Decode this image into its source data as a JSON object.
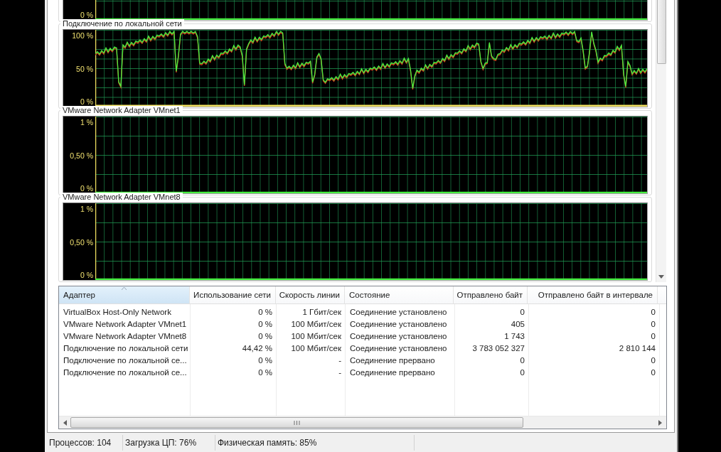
{
  "graphs": [
    {
      "kind": "flat",
      "ticks": [
        "0 %"
      ]
    },
    {
      "title": "Подключение по локальной сети",
      "kind": "activity",
      "ticks": [
        "100 %",
        "50 %",
        "0 %"
      ]
    },
    {
      "title": "VMware Network Adapter VMnet1",
      "kind": "flat",
      "ticks": [
        "1 %",
        "0,50 %",
        "0 %"
      ]
    },
    {
      "title": "VMware Network Adapter VMnet8",
      "kind": "flat",
      "ticks": [
        "1 %",
        "0,50 %",
        "0 %"
      ]
    }
  ],
  "table": {
    "columns": [
      {
        "label": "Адаптер",
        "sorted": true
      },
      {
        "label": "Использование сети",
        "sorted": false
      },
      {
        "label": "Скорость линии",
        "sorted": false
      },
      {
        "label": "Состояние",
        "sorted": false
      },
      {
        "label": "Отправлено байт",
        "sorted": false
      },
      {
        "label": "Отправлено байт в интервале",
        "sorted": false
      }
    ],
    "rows": [
      [
        "VirtualBox Host-Only Network",
        "0 %",
        "1 Гбит/сек",
        "Соединение установлено",
        "0",
        "0"
      ],
      [
        "VMware Network Adapter VMnet1",
        "0 %",
        "100 Мбит/сек",
        "Соединение установлено",
        "405",
        "0"
      ],
      [
        "VMware Network Adapter VMnet8",
        "0 %",
        "100 Мбит/сек",
        "Соединение установлено",
        "1 743",
        "0"
      ],
      [
        "Подключение по локальной сети",
        "44,42 %",
        "100 Мбит/сек",
        "Соединение установлено",
        "3 783 052 327",
        "2 810 144"
      ],
      [
        "Подключение по локальной се...",
        "0 %",
        "-",
        "Соединение прервано",
        "0",
        "0"
      ],
      [
        "Подключение по локальной се...",
        "0 %",
        "-",
        "Соединение прервано",
        "0",
        "0"
      ]
    ]
  },
  "status_bar": [
    "Процессов: 104",
    "Загрузка ЦП: 76%",
    "Физическая память: 85%"
  ]
}
